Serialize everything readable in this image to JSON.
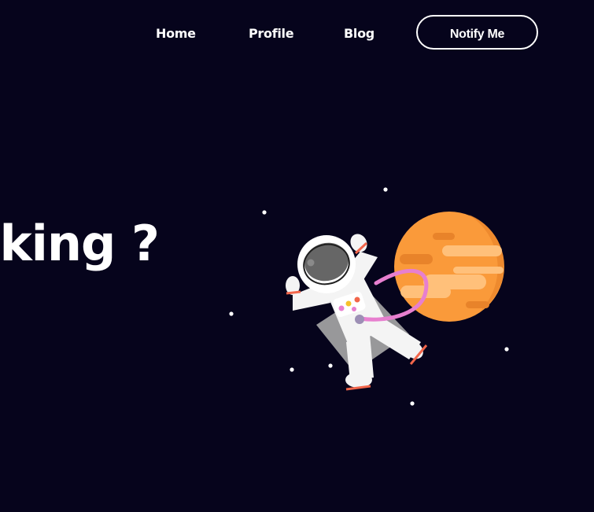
{
  "nav": {
    "items": [
      {
        "label": "Home"
      },
      {
        "label": "Profile"
      },
      {
        "label": "Blog"
      }
    ],
    "notify_label": "Notify Me"
  },
  "hero": {
    "heading": "oking ?"
  },
  "colors": {
    "background": "#06041c",
    "text": "#ffffff",
    "planet": "#fa9a3a",
    "planet_stripes": "#ffc07a",
    "tether": "#e77fcf",
    "suit": "#f4f4f4",
    "accent_red": "#f2664b"
  }
}
